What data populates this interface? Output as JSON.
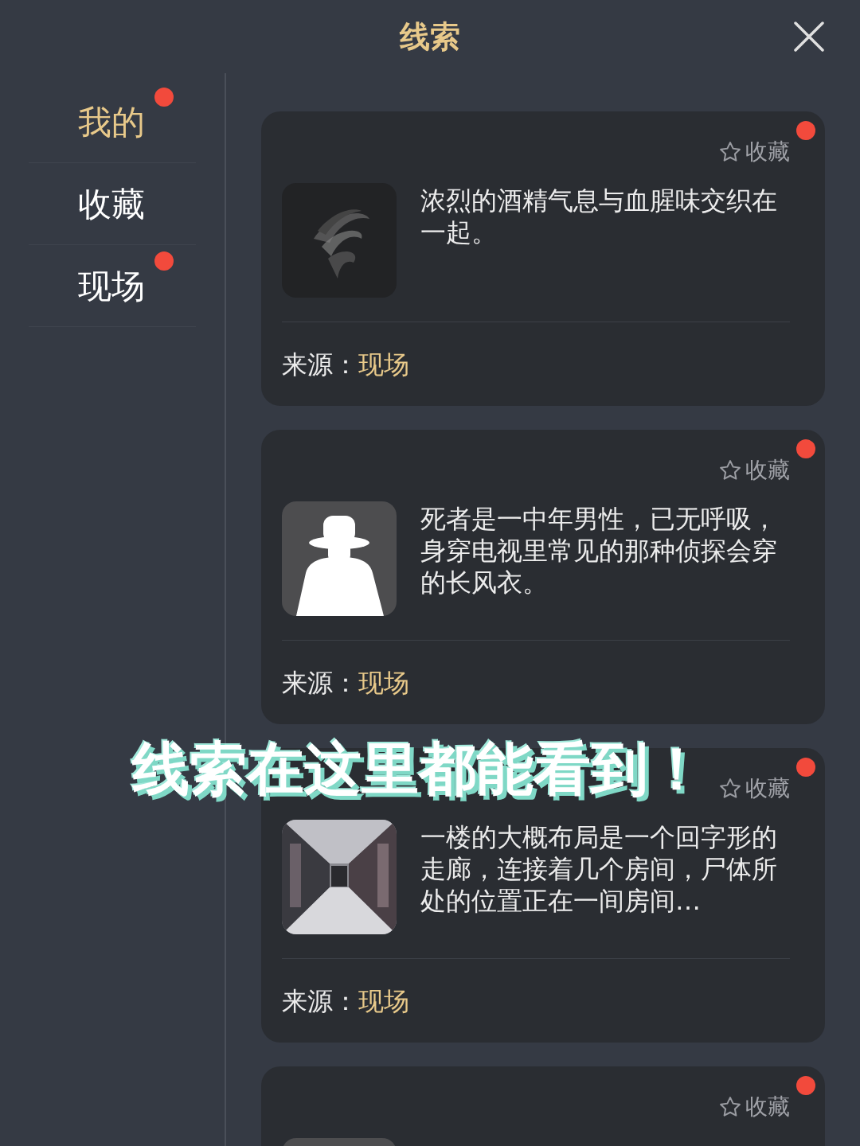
{
  "header": {
    "title": "线索"
  },
  "sidebar": {
    "items": [
      {
        "label": "我的",
        "selected": true,
        "unread": true
      },
      {
        "label": "收藏",
        "selected": false,
        "unread": false
      },
      {
        "label": "现场",
        "selected": false,
        "unread": true
      }
    ]
  },
  "cards": [
    {
      "unread": true,
      "bookmarked": false,
      "bookmark_label": "收藏",
      "text": "浓烈的酒精气息与血腥味交织在一起。",
      "source_label": "来源：",
      "source": "现场"
    },
    {
      "unread": true,
      "bookmarked": false,
      "bookmark_label": "收藏",
      "text": "死者是一中年男性，已无呼吸，身穿电视里常见的那种侦探会穿的长风衣。",
      "source_label": "来源：",
      "source": "现场"
    },
    {
      "unread": true,
      "bookmarked": false,
      "bookmark_label": "收藏",
      "text": "一楼的大概布局是一个回字形的走廊，连接着几个房间，尸体所处的位置正在一间房间…",
      "source_label": "来源：",
      "source": "现场"
    },
    {
      "unread": true,
      "bookmarked": false,
      "bookmark_label": "收藏"
    }
  ],
  "overlay_caption": "线索在这里都能看到！"
}
